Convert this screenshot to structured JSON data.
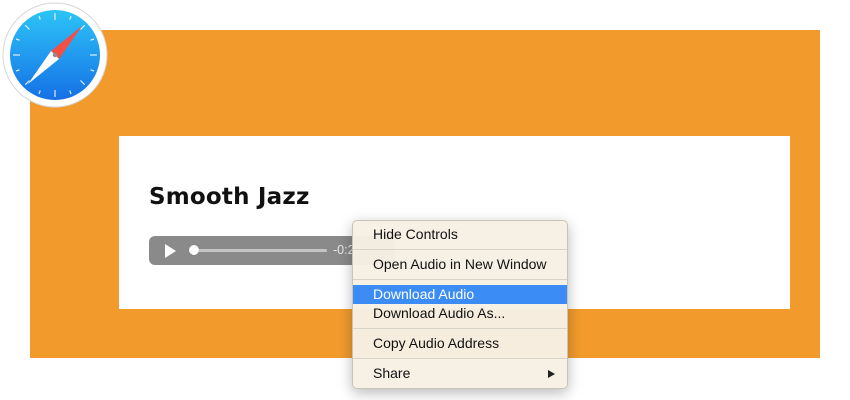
{
  "app": {
    "logo_icon": "safari-compass-icon"
  },
  "colors": {
    "page_background": "#f29b2c",
    "card_background": "#ffffff",
    "player_background": "#8a8a8a",
    "menu_highlight": "#3b8df5"
  },
  "card": {
    "title": "Smooth Jazz"
  },
  "player": {
    "play_icon": "play-icon",
    "time_remaining": "-0:20",
    "progress": 0.0
  },
  "context_menu": {
    "items": [
      {
        "label": "Hide Controls"
      },
      {
        "label": "Open Audio in New Window"
      },
      {
        "label": "Download Audio",
        "highlighted": true
      },
      {
        "label": "Download Audio As..."
      },
      {
        "label": "Copy Audio Address"
      },
      {
        "label": "Share",
        "has_submenu": true
      }
    ]
  }
}
